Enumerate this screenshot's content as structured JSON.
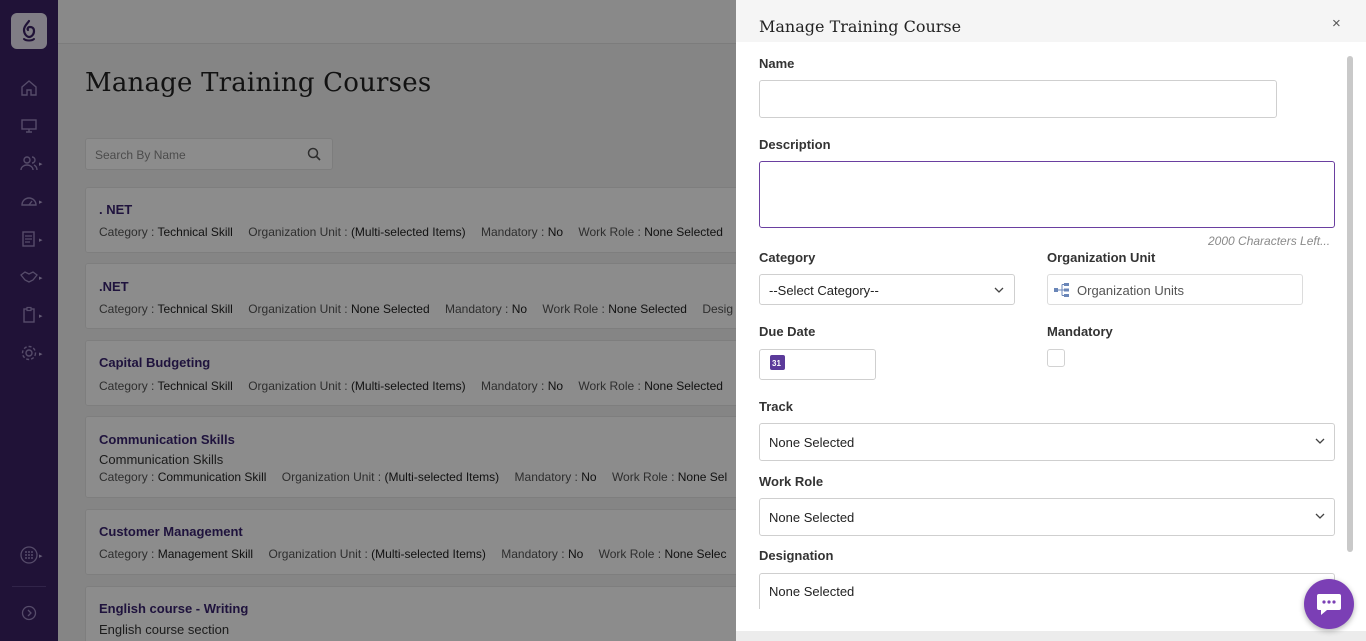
{
  "page": {
    "title": "Manage Training Courses",
    "search_placeholder": "Search By Name"
  },
  "courses": [
    {
      "title": ". NET",
      "meta": [
        {
          "k": "Category :",
          "v": "Technical Skill"
        },
        {
          "k": "Organization Unit :",
          "v": "(Multi-selected Items)"
        },
        {
          "k": "Mandatory :",
          "v": "No"
        },
        {
          "k": "Work Role :",
          "v": "None Selected"
        }
      ]
    },
    {
      "title": ".NET",
      "meta": [
        {
          "k": "Category :",
          "v": "Technical Skill"
        },
        {
          "k": "Organization Unit :",
          "v": "None Selected"
        },
        {
          "k": "Mandatory :",
          "v": "No"
        },
        {
          "k": "Work Role :",
          "v": "None Selected"
        },
        {
          "k": "Desig",
          "v": ""
        }
      ]
    },
    {
      "title": "Capital Budgeting",
      "meta": [
        {
          "k": "Category :",
          "v": "Technical Skill"
        },
        {
          "k": "Organization Unit :",
          "v": "(Multi-selected Items)"
        },
        {
          "k": "Mandatory :",
          "v": "No"
        },
        {
          "k": "Work Role :",
          "v": "None Selected"
        }
      ]
    },
    {
      "title": "Communication Skills",
      "subtitle": "Communication Skills",
      "meta": [
        {
          "k": "Category :",
          "v": "Communication Skill"
        },
        {
          "k": "Organization Unit :",
          "v": "(Multi-selected Items)"
        },
        {
          "k": "Mandatory :",
          "v": "No"
        },
        {
          "k": "Work Role :",
          "v": "None Sel"
        }
      ]
    },
    {
      "title": "Customer Management",
      "meta": [
        {
          "k": "Category :",
          "v": "Management Skill"
        },
        {
          "k": "Organization Unit :",
          "v": "(Multi-selected Items)"
        },
        {
          "k": "Mandatory :",
          "v": "No"
        },
        {
          "k": "Work Role :",
          "v": "None Selec"
        }
      ]
    },
    {
      "title": "English course - Writing",
      "subtitle": "English course section"
    }
  ],
  "modal": {
    "title": "Manage Training Course",
    "close_label": "×",
    "name_label": "Name",
    "name_value": "",
    "description_label": "Description",
    "description_value": "",
    "chars_left": "2000 Characters Left...",
    "category_label": "Category",
    "category_value": "--Select Category--",
    "org_unit_label": "Organization Unit",
    "org_unit_placeholder": "Organization Units",
    "due_date_label": "Due Date",
    "due_date_icon_text": "31",
    "mandatory_label": "Mandatory",
    "mandatory_checked": false,
    "track_label": "Track",
    "track_value": "None Selected",
    "work_role_label": "Work Role",
    "work_role_value": "None Selected",
    "designation_label": "Designation",
    "designation_value": "None Selected"
  },
  "icons": {
    "logo": "brand-logo-icon",
    "nav": [
      "home-icon",
      "monitor-icon",
      "users-icon",
      "dashboard-icon",
      "document-icon",
      "handshake-icon",
      "clipboard-icon",
      "settings-icon",
      "apps-grid-icon",
      "logout-icon"
    ],
    "chat": "chat-icon"
  },
  "colors": {
    "rail": "#3b2164",
    "accent": "#3a2470",
    "chat": "#7b3fb5",
    "focus_border": "#6a3fa0"
  }
}
